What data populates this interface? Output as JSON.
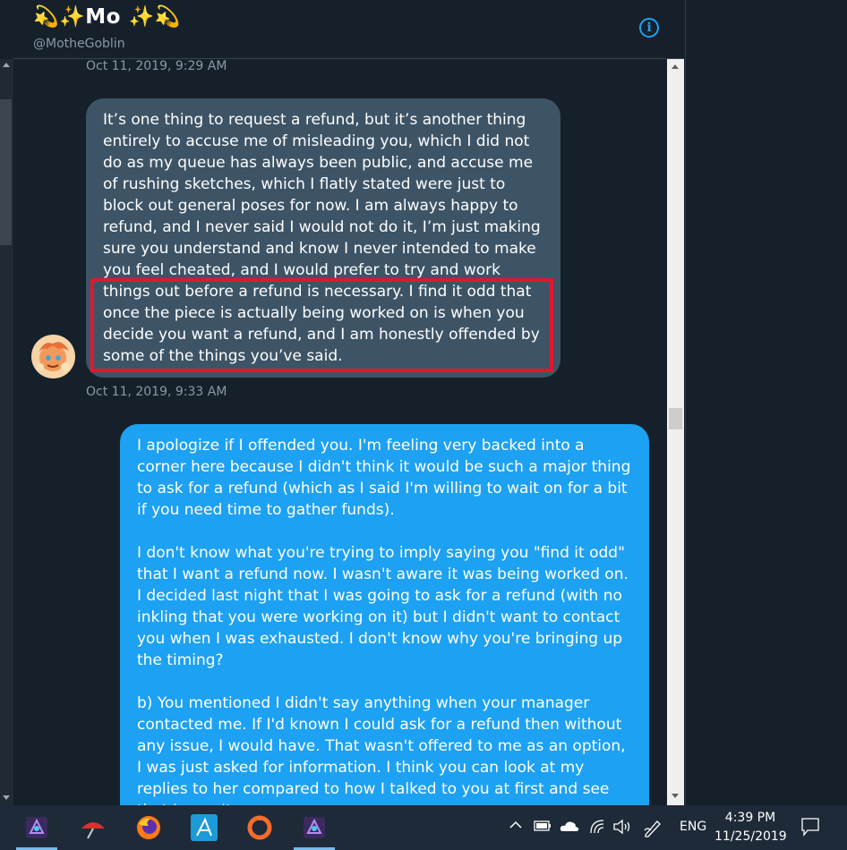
{
  "header": {
    "display_name": "💫✨Mo ✨💫",
    "handle": "@MotheGoblin",
    "info_icon": "info-icon"
  },
  "conversation": {
    "timestamp_top": "Oct 11, 2019, 9:29 AM",
    "incoming_message": "It’s one thing to request a refund, but it’s another thing entirely to accuse me of misleading you, which I did not do as my queue has always been public, and accuse me of rushing sketches, which I flatly stated were just to block out general poses for now. I am always happy to refund, and I never said I would not do it, I’m just making sure you understand and know I never intended to make you feel cheated, and I would prefer to try and work things out before a refund is necessary. I find it odd that once the piece is actually being worked on is when you decide you want a refund, and I am honestly offended by some of the things you’ve said.",
    "timestamp_incoming": "Oct 11, 2019, 9:33 AM",
    "outgoing_paragraphs": [
      "I apologize if I offended you. I'm feeling very backed into a corner here because I didn't think it would be such a major thing to ask for a refund (which as I said I'm willing to wait on for a bit if you need time to gather funds).",
      "I don't know what you're trying to imply saying you \"find it odd\" that I want a refund now. I wasn't aware it was being worked on. I decided last night that I was going to ask for a refund (with no inkling that you were working on it) but I didn't want to contact you when I was exhausted. I don't know why you're bringing up the timing?",
      "b) You mentioned I didn't say anything when your manager contacted me. If I'd known I could ask for a refund then without any issue, I would have. That wasn't offered to me as an option, I was just asked for information. I think you can look at my replies to her compared to how I talked to you at first and see that I wasn't"
    ],
    "highlight_color": "#e3162e",
    "incoming_bubble_color": "#3d5466",
    "outgoing_bubble_color": "#1da1f2"
  },
  "taskbar": {
    "apps": [
      {
        "name": "Affinity Photo",
        "icon": "affinity-photo-icon"
      },
      {
        "name": "Paint Tool",
        "icon": "brush-umbrella-icon"
      },
      {
        "name": "Firefox",
        "icon": "firefox-icon"
      },
      {
        "name": "Affinity Designer",
        "icon": "affinity-designer-icon"
      },
      {
        "name": "Origin",
        "icon": "origin-icon"
      },
      {
        "name": "Affinity Photo",
        "icon": "affinity-photo-icon"
      }
    ],
    "language": "ENG",
    "time": "4:39 PM",
    "date": "11/25/2019"
  }
}
